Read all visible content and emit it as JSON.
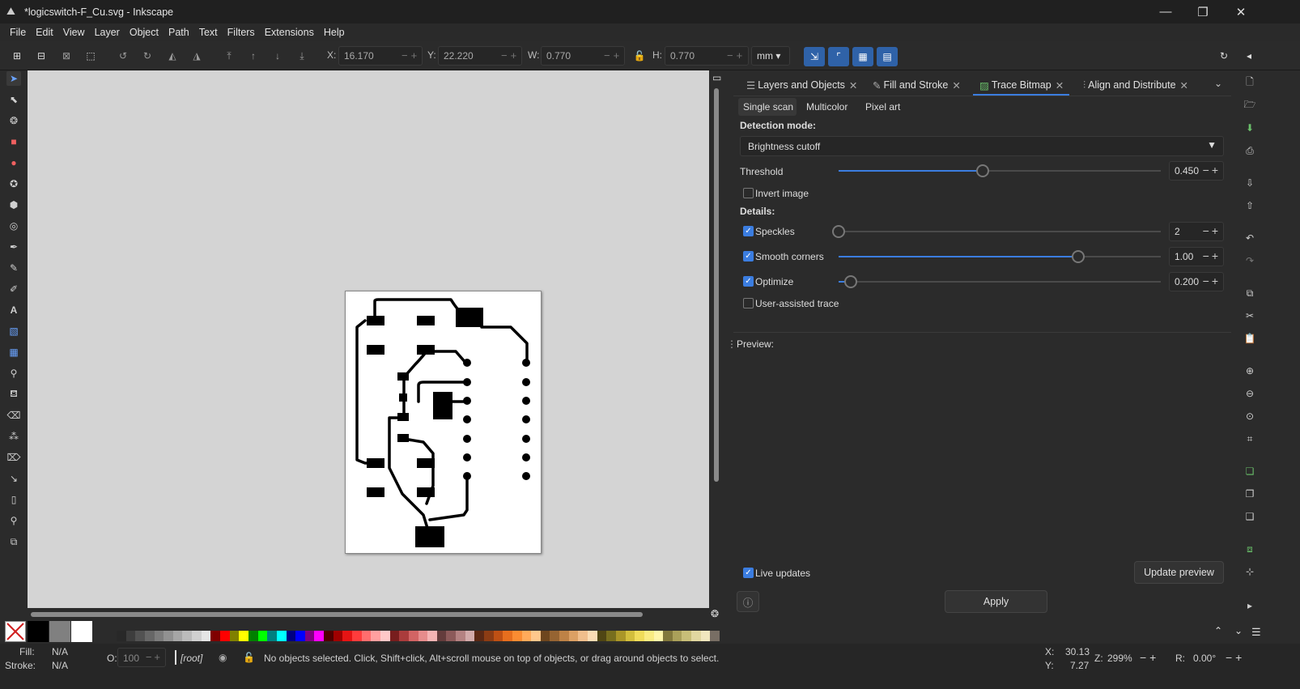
{
  "window": {
    "title": "*logicswitch-F_Cu.svg - Inkscape",
    "minimize": "—",
    "maximize": "❐",
    "close": "✕"
  },
  "menu": [
    "File",
    "Edit",
    "View",
    "Layer",
    "Object",
    "Path",
    "Text",
    "Filters",
    "Extensions",
    "Help"
  ],
  "toolbar": {
    "x_label": "X:",
    "x_value": "16.170",
    "y_label": "Y:",
    "y_value": "22.220",
    "w_label": "W:",
    "w_value": "0.770",
    "h_label": "H:",
    "h_value": "0.770",
    "unit": "mm"
  },
  "dock": {
    "tabs": [
      {
        "label": "Layers and Objects",
        "icon": "layers-icon"
      },
      {
        "label": "Fill and Stroke",
        "icon": "fill-stroke-icon"
      },
      {
        "label": "Trace Bitmap",
        "icon": "trace-bitmap-icon",
        "active": true
      },
      {
        "label": "Align and Distribute",
        "icon": "align-icon"
      }
    ],
    "subtabs": [
      "Single scan",
      "Multicolor",
      "Pixel art"
    ],
    "detection_mode_label": "Detection mode:",
    "detection_mode_value": "Brightness cutoff",
    "threshold_label": "Threshold",
    "threshold_value": "0.450",
    "threshold_level": 0.45,
    "invert_label": "Invert image",
    "details_label": "Details:",
    "speckles_label": "Speckles",
    "speckles_value": "2",
    "smooth_label": "Smooth corners",
    "smooth_value": "1.00",
    "optimize_label": "Optimize",
    "optimize_value": "0.200",
    "user_assisted_label": "User-assisted trace",
    "preview_label": "Preview:",
    "live_updates_label": "Live updates",
    "update_preview_label": "Update preview",
    "apply_label": "Apply"
  },
  "status": {
    "fill_label": "Fill:",
    "fill_value": "N/A",
    "stroke_label": "Stroke:",
    "stroke_value": "N/A",
    "opacity_label": "O:",
    "opacity_value": "100",
    "layer": "[root]",
    "message": "No objects selected. Click, Shift+click, Alt+scroll mouse on top of objects, or drag around objects to select.",
    "x_label": "X:",
    "x_value": "30.13",
    "y_label": "Y:",
    "y_value": "7.27",
    "zoom_label": "Z:",
    "zoom_value": "299%",
    "rotate_label": "R:",
    "rotate_value": "0.00°"
  },
  "colors": {
    "accent": "#3b7de0",
    "panel": "#2b2b2b",
    "canvas": "#d4d4d4"
  }
}
